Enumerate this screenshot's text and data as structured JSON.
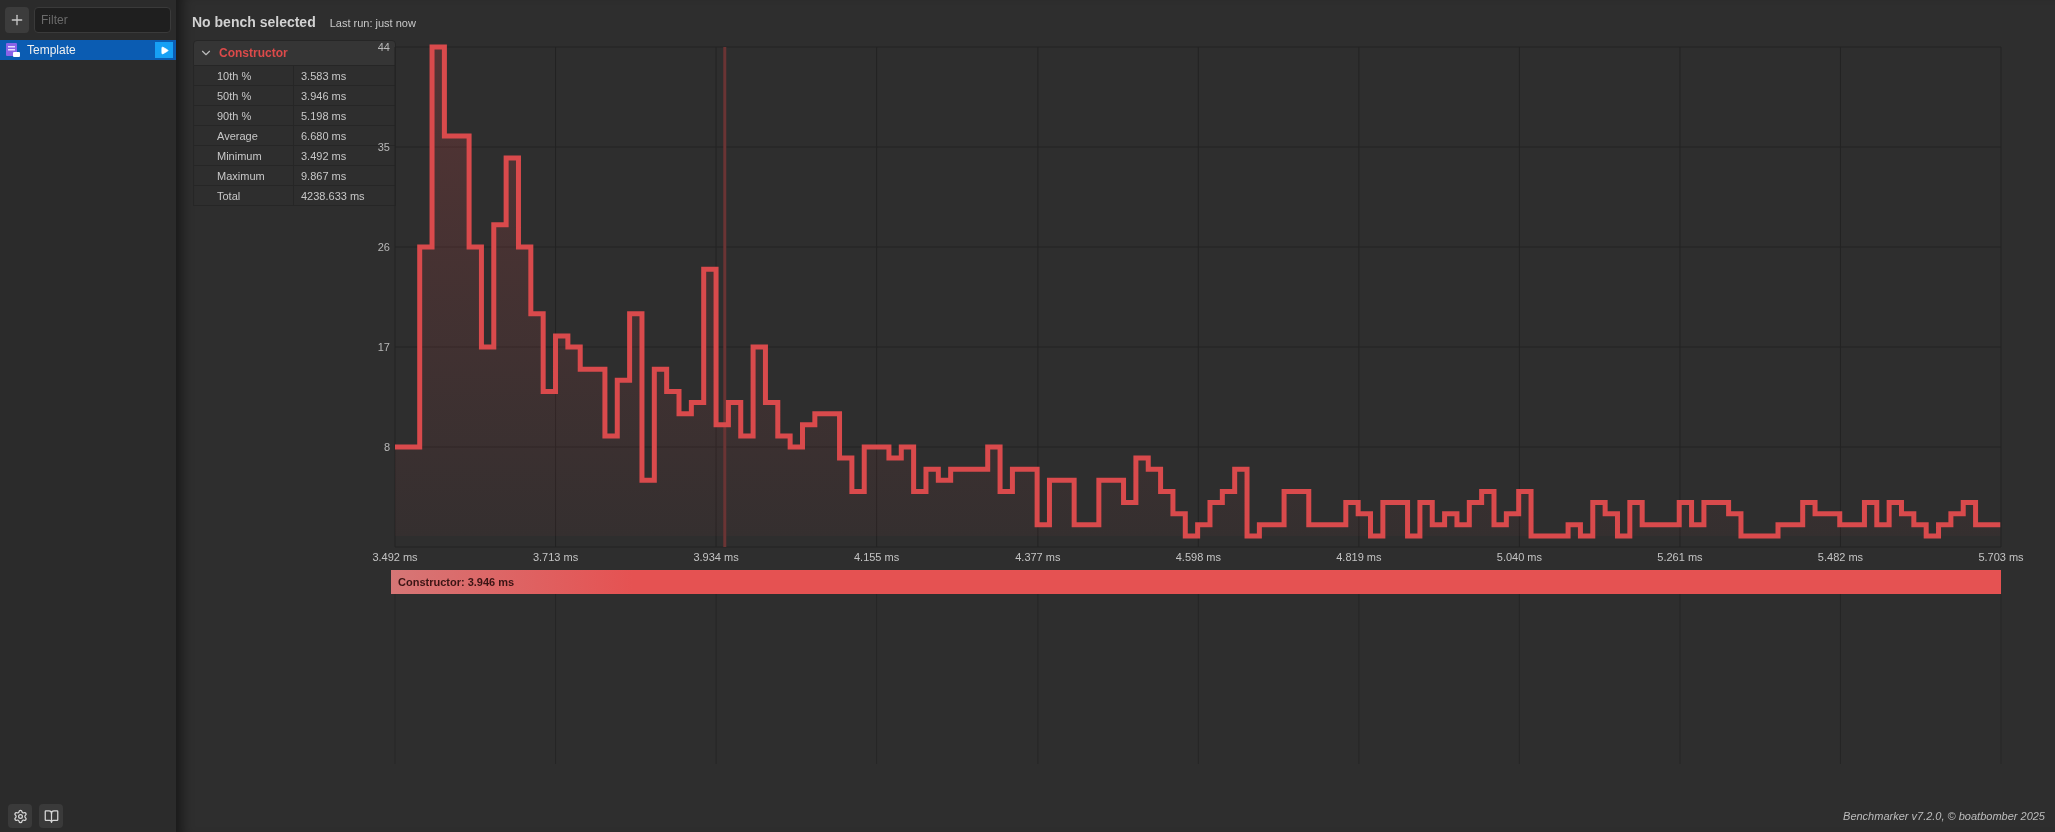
{
  "sidebar": {
    "filter": {
      "placeholder": "Filter"
    },
    "items": [
      {
        "label": "Template",
        "selected": true
      }
    ]
  },
  "header": {
    "title": "No bench selected",
    "last_run": "Last run: just now"
  },
  "stats": {
    "title": "Constructor",
    "expanded": true,
    "rows": [
      {
        "label": "10th %",
        "value": "3.583 ms"
      },
      {
        "label": "50th %",
        "value": "3.946 ms"
      },
      {
        "label": "90th %",
        "value": "5.198 ms"
      },
      {
        "label": "Average",
        "value": "6.680 ms"
      },
      {
        "label": "Minimum",
        "value": "3.492 ms"
      },
      {
        "label": "Maximum",
        "value": "9.867 ms"
      },
      {
        "label": "Total",
        "value": "4238.633 ms"
      }
    ]
  },
  "chart": {
    "chart_data": {
      "type": "area",
      "xlim": [
        3.492,
        5.703
      ],
      "ylim": [
        -1,
        44
      ],
      "grid": true,
      "xticks": [
        {
          "value": 3.492,
          "label": "3.492 ms"
        },
        {
          "value": 3.713,
          "label": "3.713 ms"
        },
        {
          "value": 3.934,
          "label": "3.934 ms"
        },
        {
          "value": 4.155,
          "label": "4.155 ms"
        },
        {
          "value": 4.377,
          "label": "4.377 ms"
        },
        {
          "value": 4.598,
          "label": "4.598 ms"
        },
        {
          "value": 4.819,
          "label": "4.819 ms"
        },
        {
          "value": 5.04,
          "label": "5.040 ms"
        },
        {
          "value": 5.261,
          "label": "5.261 ms"
        },
        {
          "value": 5.482,
          "label": "5.482 ms"
        },
        {
          "value": 5.703,
          "label": "5.703 ms"
        }
      ],
      "yticks": [
        8,
        17,
        26,
        35,
        44
      ],
      "x": [
        3.492,
        3.526,
        3.526,
        3.543,
        3.543,
        3.56,
        3.56,
        3.594,
        3.594,
        3.611,
        3.611,
        3.628,
        3.628,
        3.645,
        3.645,
        3.662,
        3.662,
        3.679,
        3.679,
        3.696,
        3.696,
        3.713,
        3.713,
        3.73,
        3.73,
        3.747,
        3.747,
        3.781,
        3.781,
        3.798,
        3.798,
        3.815,
        3.815,
        3.832,
        3.832,
        3.849,
        3.849,
        3.866,
        3.866,
        3.883,
        3.883,
        3.9,
        3.9,
        3.917,
        3.917,
        3.934,
        3.934,
        3.951,
        3.951,
        3.968,
        3.968,
        3.985,
        3.985,
        4.002,
        4.002,
        4.019,
        4.019,
        4.036,
        4.036,
        4.053,
        4.053,
        4.07,
        4.07,
        4.104,
        4.104,
        4.121,
        4.121,
        4.138,
        4.138,
        4.172,
        4.172,
        4.189,
        4.189,
        4.206,
        4.206,
        4.223,
        4.223,
        4.24,
        4.24,
        4.257,
        4.257,
        4.308,
        4.308,
        4.325,
        4.325,
        4.342,
        4.342,
        4.376,
        4.376,
        4.393,
        4.393,
        4.427,
        4.427,
        4.461,
        4.461,
        4.495,
        4.495,
        4.512,
        4.512,
        4.529,
        4.529,
        4.546,
        4.546,
        4.563,
        4.563,
        4.58,
        4.58,
        4.597,
        4.597,
        4.614,
        4.614,
        4.631,
        4.631,
        4.648,
        4.648,
        4.665,
        4.665,
        4.682,
        4.682,
        4.716,
        4.716,
        4.75,
        4.75,
        4.801,
        4.801,
        4.818,
        4.818,
        4.835,
        4.835,
        4.852,
        4.852,
        4.886,
        4.886,
        4.903,
        4.903,
        4.92,
        4.92,
        4.937,
        4.937,
        4.954,
        4.954,
        4.971,
        4.971,
        4.988,
        4.988,
        5.005,
        5.005,
        5.022,
        5.022,
        5.039,
        5.039,
        5.056,
        5.056,
        5.107,
        5.107,
        5.124,
        5.124,
        5.141,
        5.141,
        5.158,
        5.158,
        5.175,
        5.175,
        5.192,
        5.192,
        5.209,
        5.209,
        5.26,
        5.26,
        5.277,
        5.277,
        5.294,
        5.294,
        5.328,
        5.328,
        5.345,
        5.345,
        5.396,
        5.396,
        5.43,
        5.43,
        5.447,
        5.447,
        5.481,
        5.481,
        5.515,
        5.515,
        5.532,
        5.532,
        5.549,
        5.549,
        5.566,
        5.566,
        5.583,
        5.583,
        5.6,
        5.6,
        5.617,
        5.617,
        5.634,
        5.634,
        5.651,
        5.651,
        5.668,
        5.668,
        5.702
      ],
      "series": [
        {
          "name": "Constructor",
          "color": "#d94a4c",
          "values": [
            8,
            8,
            26,
            26,
            44,
            44,
            36,
            36,
            26,
            26,
            17,
            17,
            28,
            28,
            34,
            34,
            26,
            26,
            20,
            20,
            13,
            13,
            18,
            18,
            17,
            17,
            15,
            15,
            9,
            9,
            14,
            14,
            20,
            20,
            5,
            5,
            15,
            15,
            13,
            13,
            11,
            11,
            12,
            12,
            24,
            24,
            10,
            10,
            12,
            12,
            9,
            9,
            17,
            17,
            12,
            12,
            9,
            9,
            8,
            8,
            10,
            10,
            11,
            11,
            7,
            7,
            4,
            4,
            8,
            8,
            7,
            7,
            8,
            8,
            4,
            4,
            6,
            6,
            5,
            5,
            6,
            6,
            8,
            8,
            4,
            4,
            6,
            6,
            1,
            1,
            5,
            5,
            1,
            1,
            5,
            5,
            3,
            3,
            7,
            7,
            6,
            6,
            4,
            4,
            2,
            2,
            0,
            0,
            1,
            1,
            3,
            3,
            4,
            4,
            6,
            6,
            0,
            0,
            1,
            1,
            4,
            4,
            1,
            1,
            3,
            3,
            2,
            2,
            0,
            0,
            3,
            3,
            0,
            0,
            3,
            3,
            1,
            1,
            2,
            2,
            1,
            1,
            3,
            3,
            4,
            4,
            1,
            1,
            2,
            2,
            4,
            4,
            0,
            0,
            1,
            1,
            0,
            0,
            3,
            3,
            2,
            2,
            0,
            0,
            3,
            3,
            1,
            1,
            3,
            3,
            1,
            1,
            3,
            3,
            2,
            2,
            0,
            0,
            1,
            1,
            3,
            3,
            2,
            2,
            1,
            1,
            3,
            3,
            1,
            1,
            3,
            3,
            2,
            2,
            1,
            1,
            0,
            0,
            1,
            1,
            2,
            2,
            3,
            3,
            1,
            1
          ]
        }
      ],
      "ref_lines": [
        {
          "axis": "x",
          "value": 3.946
        }
      ]
    }
  },
  "legend": {
    "suffix": ": 3.946 ms",
    "color": "#e55252"
  },
  "footer": {
    "credit": "Benchmarker v7.2.0, © boatbomber 2025"
  }
}
